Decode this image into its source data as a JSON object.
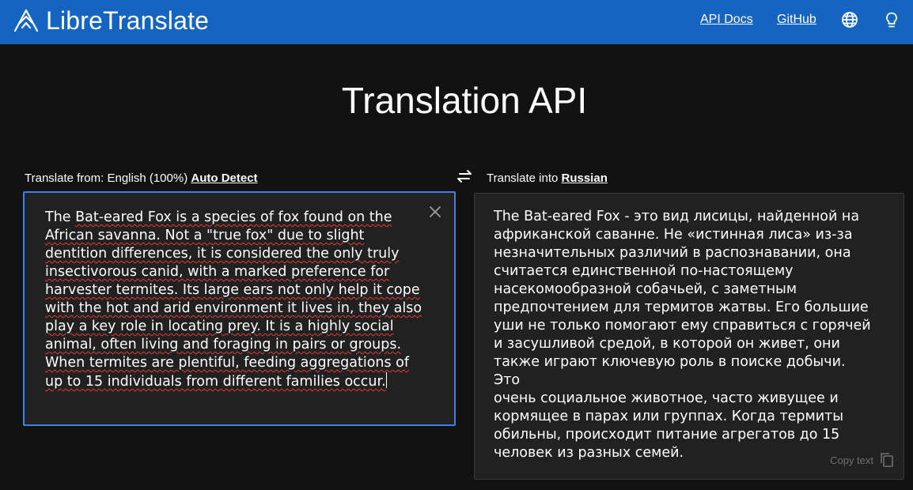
{
  "navbar": {
    "brand": "LibreTranslate",
    "api_docs": "API Docs",
    "github": "GitHub",
    "icons": [
      "globe-icon",
      "lightbulb-icon"
    ],
    "color": "#1565c0"
  },
  "page": {
    "title": "Translation API"
  },
  "source": {
    "label_prefix": "Translate from: English (100%)",
    "auto_detect": "Auto Detect",
    "lines": [
      [
        "The ",
        "Bat-eared Fox is a species of fox found on the"
      ],
      [
        "",
        "African savanna. Not a \"true fox\" due to slight"
      ],
      [
        "",
        "dentition differences, it is considered the only truly"
      ],
      [
        "",
        "insectivorous canid, with a marked preference for"
      ],
      [
        "",
        "harvester termites. Its large ears not only help it cope"
      ],
      [
        "",
        "with the hot and arid environment it lives in, they also"
      ],
      [
        "",
        "play a key role in locating prey. It is a highly social"
      ],
      [
        "",
        "animal, often living and foraging in pairs or groups."
      ],
      [
        "",
        "When termites are plentiful, feeding aggregations of"
      ],
      [
        "",
        "up to 15 individuals from different families occur."
      ]
    ]
  },
  "target": {
    "label_prefix": "Translate into",
    "language": "Russian",
    "text": "The Bat-eared Fox - это вид лисицы, найденной на\nафриканской саванне. Не «истинная лиса» из-за\nнезначительных различий в распознавании, она\nсчитается единственной по-настоящему\nнасекомообразной собачьей, с заметным\nпредпочтением для термитов жатвы. Его большие\nуши не только помогают ему справиться с горячей\nи засушливой средой, в которой он живет, они\nтакже играют ключевую роль в поиске добычи. Это\nочень социальное животное, часто живущее и\nкормящее в парах или группах. Когда термиты\nобильны, происходит питание агрегатов до 15\nчеловек из разных семей.",
    "copy_label": "Copy text"
  },
  "colors": {
    "focus_border": "#3b82e6",
    "spell_error": "#e53935",
    "background": "#121212"
  }
}
